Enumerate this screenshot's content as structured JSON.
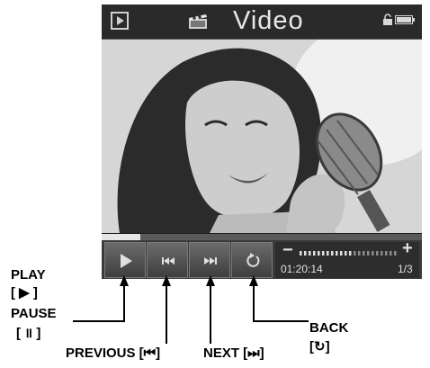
{
  "titlebar": {
    "title": "Video",
    "mode_icon": "play-mode-icon",
    "clapper_icon": "clapperboard-icon",
    "lock_icon": "lock-icon",
    "battery_icon": "battery-icon"
  },
  "playback": {
    "progress": 0.12,
    "time": "01:20:14",
    "page": "1/3",
    "volume_level": 0.55
  },
  "controls": [
    {
      "name": "play-button",
      "icon": "play-icon"
    },
    {
      "name": "prev-button",
      "icon": "previous-icon"
    },
    {
      "name": "next-button",
      "icon": "next-icon"
    },
    {
      "name": "back-button",
      "icon": "back-icon"
    }
  ],
  "volume": {
    "minus": "−",
    "plus": "+"
  },
  "callouts": {
    "play_label": "PLAY",
    "play_symbol": "[ ▶ ]",
    "pause_label": "PAUSE",
    "pause_symbol": "[ ॥ ]",
    "previous_label": "PREVIOUS [⏮]",
    "next_label": "NEXT [⏭]",
    "back_label": "BACK",
    "back_symbol": "[↻]"
  }
}
